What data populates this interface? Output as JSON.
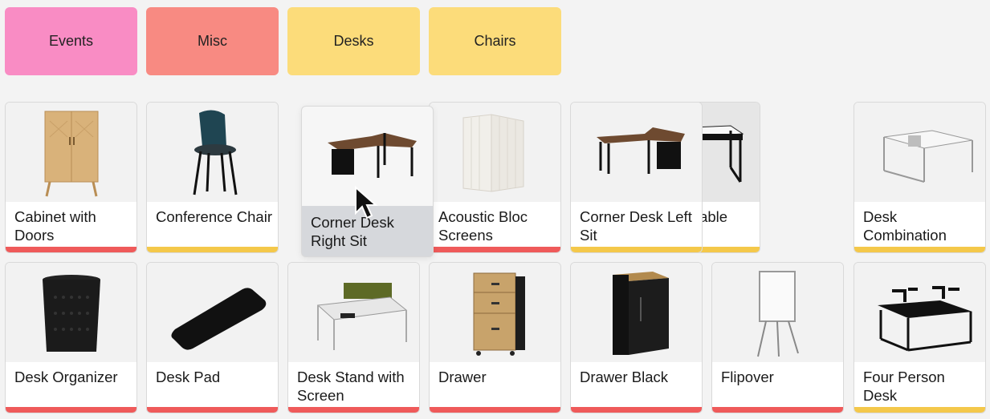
{
  "categories": [
    {
      "label": "Events",
      "color": "#f98cc4"
    },
    {
      "label": "Misc",
      "color": "#f88a82"
    },
    {
      "label": "Desks",
      "color": "#fcdc7a"
    },
    {
      "label": "Chairs",
      "color": "#fcdc7a"
    }
  ],
  "colors": {
    "misc": "#ef5a5a",
    "desk": "#f4c84a"
  },
  "products": [
    {
      "name": "Cabinet with Doors",
      "icon": "cabinet-image",
      "category_color": "#ef5a5a"
    },
    {
      "name": "Conference Chair",
      "icon": "chair-image",
      "category_color": "#f4c84a"
    },
    {
      "name": "Corner Desk Right Sit",
      "icon": "corner-desk-image",
      "category_color": "",
      "state": "dragging"
    },
    {
      "name": "Acoustic Bloc Screens",
      "icon": "screen-image",
      "category_color": "#ef5a5a"
    },
    {
      "name": "Corner Desk Left Sit",
      "icon": "corner-desk-image",
      "category_color": "#f4c84a"
    },
    {
      "name": "Customizable Desk",
      "icon": "desk-image",
      "category_color": "#f4c84a"
    },
    {
      "name": "Desk Combination",
      "icon": "desk-combination-image",
      "category_color": "#f4c84a"
    },
    {
      "name": "Desk Organizer",
      "icon": "organizer-image",
      "category_color": "#ef5a5a"
    },
    {
      "name": "Desk Pad",
      "icon": "desk-pad-image",
      "category_color": "#ef5a5a"
    },
    {
      "name": "Desk Stand with Screen",
      "icon": "desk-stand-image",
      "category_color": "#ef5a5a"
    },
    {
      "name": "Drawer",
      "icon": "drawer-image",
      "category_color": "#ef5a5a"
    },
    {
      "name": "Drawer Black",
      "icon": "drawer-black-image",
      "category_color": "#ef5a5a"
    },
    {
      "name": "Flipover",
      "icon": "flipover-image",
      "category_color": "#ef5a5a"
    },
    {
      "name": "Four Person Desk",
      "icon": "four-person-desk-image",
      "category_color": "#f4c84a"
    }
  ]
}
